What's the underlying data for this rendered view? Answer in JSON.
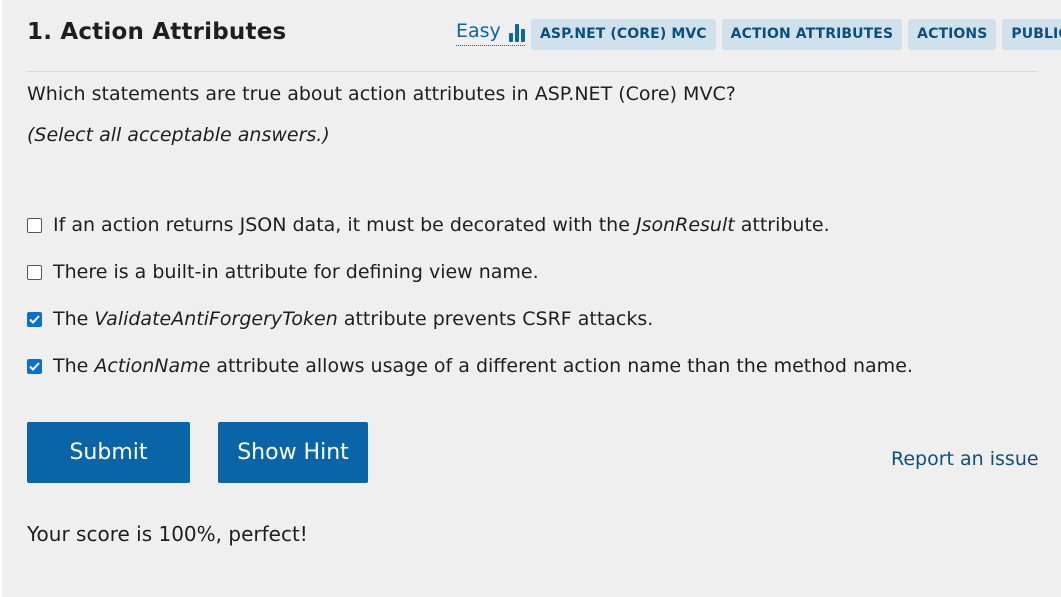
{
  "question": {
    "title": "1. Action Attributes",
    "difficulty": "Easy",
    "tags": [
      "ASP.NET (CORE) MVC",
      "ACTION ATTRIBUTES",
      "ACTIONS",
      "PUBLIC"
    ],
    "text": "Which statements are true about action attributes in ASP.NET (Core) MVC?",
    "instruction": "(Select all acceptable answers.)"
  },
  "options": [
    {
      "pre": "If an action returns JSON data, it must be decorated with the ",
      "em": "JsonResult",
      "post": " attribute.",
      "checked": false
    },
    {
      "pre": "There is a built-in attribute for defining view name.",
      "em": "",
      "post": "",
      "checked": false
    },
    {
      "pre": "The ",
      "em": "ValidateAntiForgeryToken",
      "post": " attribute prevents CSRF attacks.",
      "checked": true
    },
    {
      "pre": "The ",
      "em": "ActionName",
      "post": " attribute allows usage of a different action name than the method name.",
      "checked": true
    }
  ],
  "actions": {
    "submit": "Submit",
    "hint": "Show Hint",
    "report": "Report an issue"
  },
  "result": "Your score is 100%, perfect!",
  "colors": {
    "accent": "#0a65a8",
    "tag_bg": "#d1e1ec",
    "card_bg": "#efefef"
  },
  "icons": {
    "difficulty": "bar-chart-icon",
    "checked": "checkmark-icon"
  }
}
